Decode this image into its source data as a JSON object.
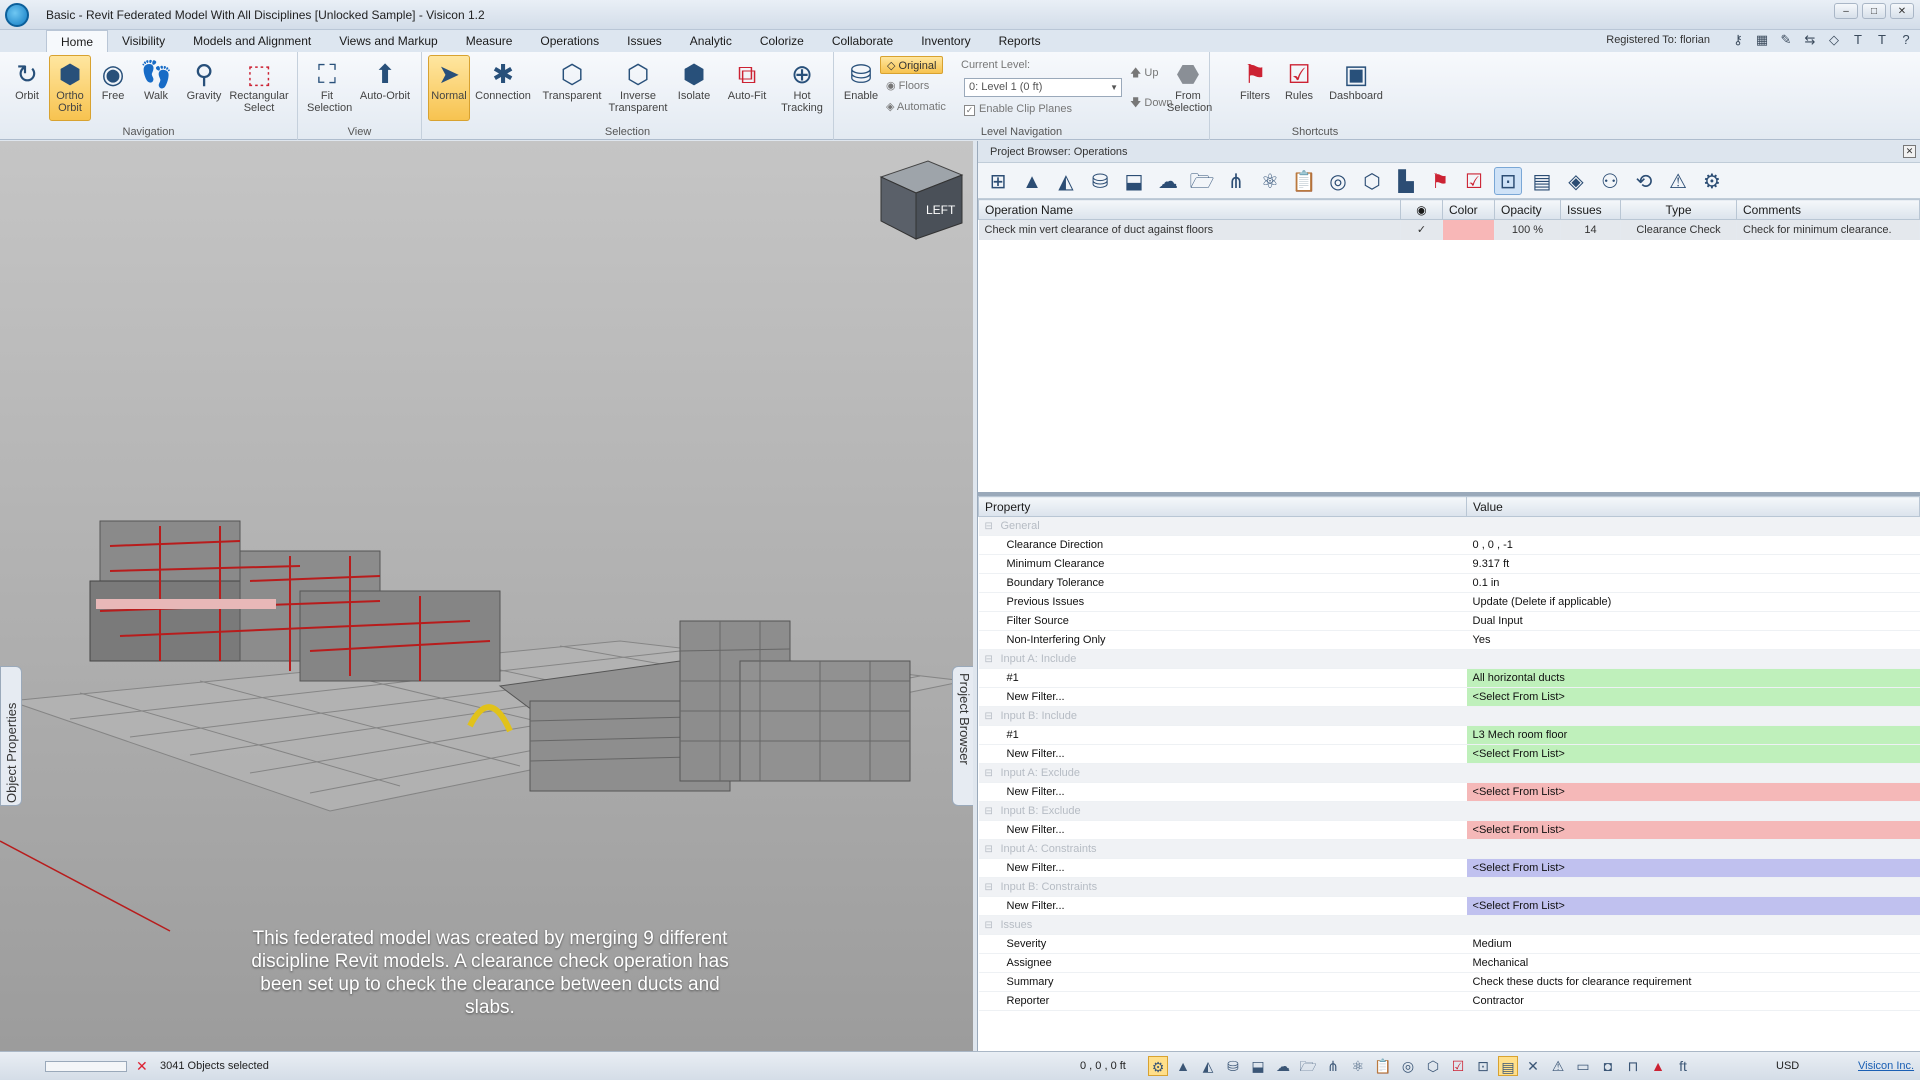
{
  "window": {
    "title": "Basic - Revit Federated Model With All Disciplines [Unlocked Sample] - Visicon 1.2",
    "controls": [
      "–",
      "□",
      "✕"
    ]
  },
  "menu": {
    "tabs": [
      "Home",
      "Visibility",
      "Models and Alignment",
      "Views and Markup",
      "Measure",
      "Operations",
      "Issues",
      "Analytic",
      "Colorize",
      "Collaborate",
      "Inventory",
      "Reports"
    ],
    "active_tab": "Home",
    "registered": "Registered To: florian"
  },
  "ribbon": {
    "navigation": {
      "label": "Navigation",
      "buttons": [
        {
          "label": "Orbit",
          "icon": "orbit-icon"
        },
        {
          "label": "Ortho Orbit",
          "icon": "ortho-orbit-icon",
          "active": true
        },
        {
          "label": "Free",
          "icon": "free-icon"
        },
        {
          "label": "Walk",
          "icon": "walk-icon"
        },
        {
          "label": "Gravity",
          "icon": "gravity-icon"
        },
        {
          "label": "Rectangular Select",
          "icon": "rectangular-select-icon"
        }
      ]
    },
    "view": {
      "label": "View",
      "buttons": [
        {
          "label": "Fit Selection",
          "icon": "fit-selection-icon"
        },
        {
          "label": "Auto-Orbit",
          "icon": "auto-orbit-icon"
        }
      ]
    },
    "selection": {
      "label": "Selection",
      "buttons": [
        {
          "label": "Normal",
          "icon": "normal-cursor-icon",
          "active": true
        },
        {
          "label": "Connection",
          "icon": "connection-icon"
        },
        {
          "label": "Transparent",
          "icon": "transparent-icon"
        },
        {
          "label": "Inverse Transparent",
          "icon": "inverse-transparent-icon"
        },
        {
          "label": "Isolate",
          "icon": "isolate-icon"
        },
        {
          "label": "Auto-Fit",
          "icon": "auto-fit-icon"
        },
        {
          "label": "Hot Tracking",
          "icon": "hot-tracking-icon"
        }
      ]
    },
    "level_navigation": {
      "label": "Level Navigation",
      "enable_label": "Enable",
      "original": "Original",
      "floors": "Floors",
      "automatic": "Automatic",
      "current_level_label": "Current Level:",
      "current_level_value": "0: Level 1 (0 ft)",
      "up": "Up",
      "down": "Down",
      "clip_planes": "Enable Clip Planes",
      "from_selection": "From Selection"
    },
    "shortcuts": {
      "label": "Shortcuts",
      "buttons": [
        {
          "label": "Filters",
          "icon": "filters-icon"
        },
        {
          "label": "Rules",
          "icon": "rules-icon"
        },
        {
          "label": "Dashboard",
          "icon": "dashboard-icon"
        }
      ]
    }
  },
  "viewport": {
    "viewcube_face": "LEFT",
    "left_tab": "Object Properties",
    "right_tab": "Project Browser",
    "caption": "This federated model was created by merging 9 different discipline Revit models. A clearance check operation has been set up to check the clearance between ducts and slabs."
  },
  "browser": {
    "title": "Project Browser: Operations",
    "columns": [
      "Operation Name",
      "◉",
      "Color",
      "Opacity",
      "Issues",
      "Type",
      "Comments"
    ],
    "rows": [
      {
        "name": "Check min vert clearance of duct against floors",
        "enabled": "✓",
        "color": "#f8b7b7",
        "opacity": "100 %",
        "issues": "14",
        "type": "Clearance Check",
        "comments": "Check for minimum clearance."
      }
    ]
  },
  "properties": {
    "columns": [
      "Property",
      "Value"
    ],
    "groups": [
      {
        "name": "General",
        "rows": [
          {
            "prop": "Clearance Direction",
            "val": "0 , 0 , -1"
          },
          {
            "prop": "Minimum Clearance",
            "val": "9.317 ft"
          },
          {
            "prop": "Boundary Tolerance",
            "val": "0.1 in"
          },
          {
            "prop": "Previous Issues",
            "val": "Update (Delete if applicable)"
          },
          {
            "prop": "Filter Source",
            "val": "Dual Input"
          },
          {
            "prop": "Non-Interfering Only",
            "val": "Yes"
          }
        ]
      },
      {
        "name": "Input A: Include",
        "rows": [
          {
            "prop": "#1",
            "val": "All horizontal ducts",
            "tone": "green"
          },
          {
            "prop": "New Filter...",
            "val": "<Select From List>",
            "tone": "green"
          }
        ]
      },
      {
        "name": "Input B: Include",
        "rows": [
          {
            "prop": "#1",
            "val": "L3 Mech room floor",
            "tone": "green"
          },
          {
            "prop": "New Filter...",
            "val": "<Select From List>",
            "tone": "green"
          }
        ]
      },
      {
        "name": "Input A: Exclude",
        "rows": [
          {
            "prop": "New Filter...",
            "val": "<Select From List>",
            "tone": "red"
          }
        ]
      },
      {
        "name": "Input B: Exclude",
        "rows": [
          {
            "prop": "New Filter...",
            "val": "<Select From List>",
            "tone": "red"
          }
        ]
      },
      {
        "name": "Input A: Constraints",
        "rows": [
          {
            "prop": "New Filter...",
            "val": "<Select From List>",
            "tone": "blue"
          }
        ]
      },
      {
        "name": "Input B: Constraints",
        "rows": [
          {
            "prop": "New Filter...",
            "val": "<Select From List>",
            "tone": "blue"
          }
        ]
      },
      {
        "name": "Issues",
        "rows": [
          {
            "prop": "Severity",
            "val": "Medium"
          },
          {
            "prop": "Assignee",
            "val": "Mechanical"
          },
          {
            "prop": "Summary",
            "val": "Check these ducts for clearance requirement"
          },
          {
            "prop": "Reporter",
            "val": "Contractor"
          }
        ]
      }
    ]
  },
  "status": {
    "selected": "3041 Objects selected",
    "coords": "0 , 0 , 0 ft",
    "currency": "USD",
    "brand": "Visicon Inc."
  },
  "colors": {
    "accent": "#f7c350",
    "row_green": "#bff0bb",
    "row_red": "#f5b8b8",
    "row_blue": "#c0c1ef"
  }
}
